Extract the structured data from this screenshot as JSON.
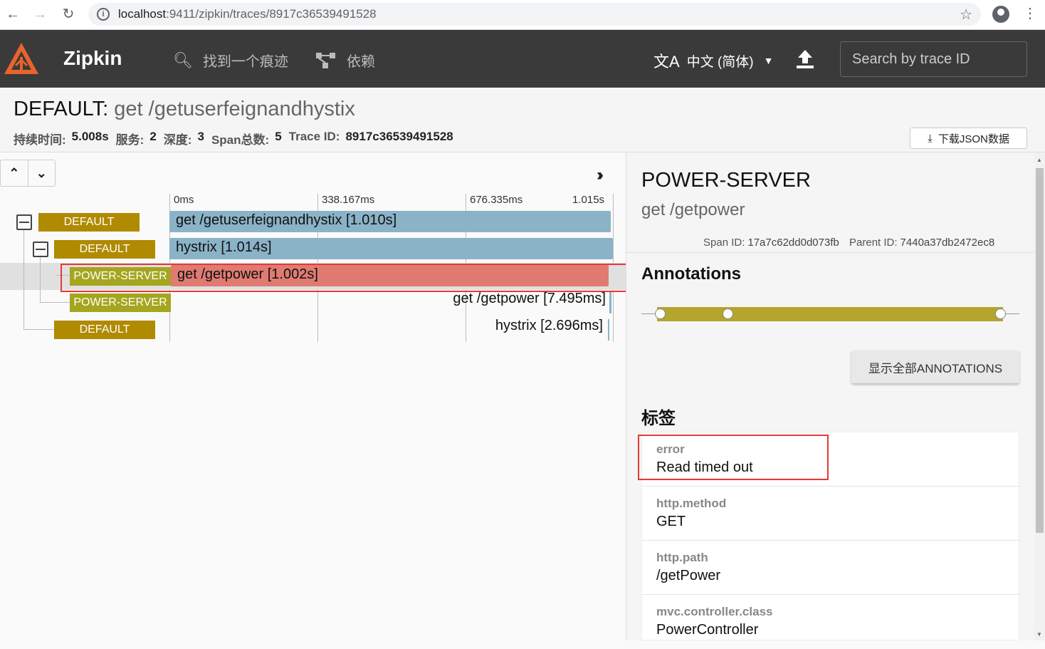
{
  "browser": {
    "url_host": "localhost",
    "url_path": ":9411/zipkin/traces/8917c36539491528"
  },
  "header": {
    "brand": "Zipkin",
    "nav_find": "找到一个痕迹",
    "nav_deps": "依赖",
    "language": "中文 (简体)",
    "search_placeholder": "Search by trace ID"
  },
  "summary": {
    "service": "DEFAULT:",
    "name": " get /getuserfeignandhystix",
    "duration_label": "持续时间:",
    "duration": "5.008s",
    "services_label": "服务:",
    "services": "2",
    "depth_label": "深度:",
    "depth": "3",
    "spans_label": "Span总数:",
    "spans": "5",
    "traceid_label": "Trace ID:",
    "traceid": "8917c36539491528",
    "download_label": "下载JSON数据"
  },
  "timeline": {
    "ticks": [
      "0ms",
      "338.167ms",
      "676.335ms",
      "1.015s"
    ],
    "rows": [
      {
        "service": "DEFAULT",
        "label": "get /getuserfeignandhystix [1.010s]"
      },
      {
        "service": "DEFAULT",
        "label": "hystrix [1.014s]"
      },
      {
        "service": "POWER-SERVER",
        "label": "get /getpower [1.002s]"
      },
      {
        "service": "POWER-SERVER",
        "label": "get /getpower [7.495ms]"
      },
      {
        "service": "DEFAULT",
        "label": "hystrix [2.696ms]"
      }
    ]
  },
  "detail": {
    "service": "POWER-SERVER",
    "name": "get /getpower",
    "span_id_label": "Span ID:",
    "span_id": "17a7c62dd0d073fb",
    "parent_id_label": "Parent ID:",
    "parent_id": "7440a37db2472ec8",
    "annotations_title": "Annotations",
    "show_all_label": "显示全部ANNOTATIONS",
    "tags_title": "标签",
    "tags": [
      {
        "key": "error",
        "value": "Read timed out"
      },
      {
        "key": "http.method",
        "value": "GET"
      },
      {
        "key": "http.path",
        "value": "/getPower"
      },
      {
        "key": "mvc.controller.class",
        "value": "PowerController"
      }
    ]
  },
  "colors": {
    "appbar": "#3a3a3a",
    "default_badge": "#b08a00",
    "power_badge": "#a5a51f",
    "bar_blue": "#8ab3c8",
    "bar_red": "#e07b72",
    "highlight_box": "#e53935",
    "annotation_bar": "#b5a52c"
  }
}
